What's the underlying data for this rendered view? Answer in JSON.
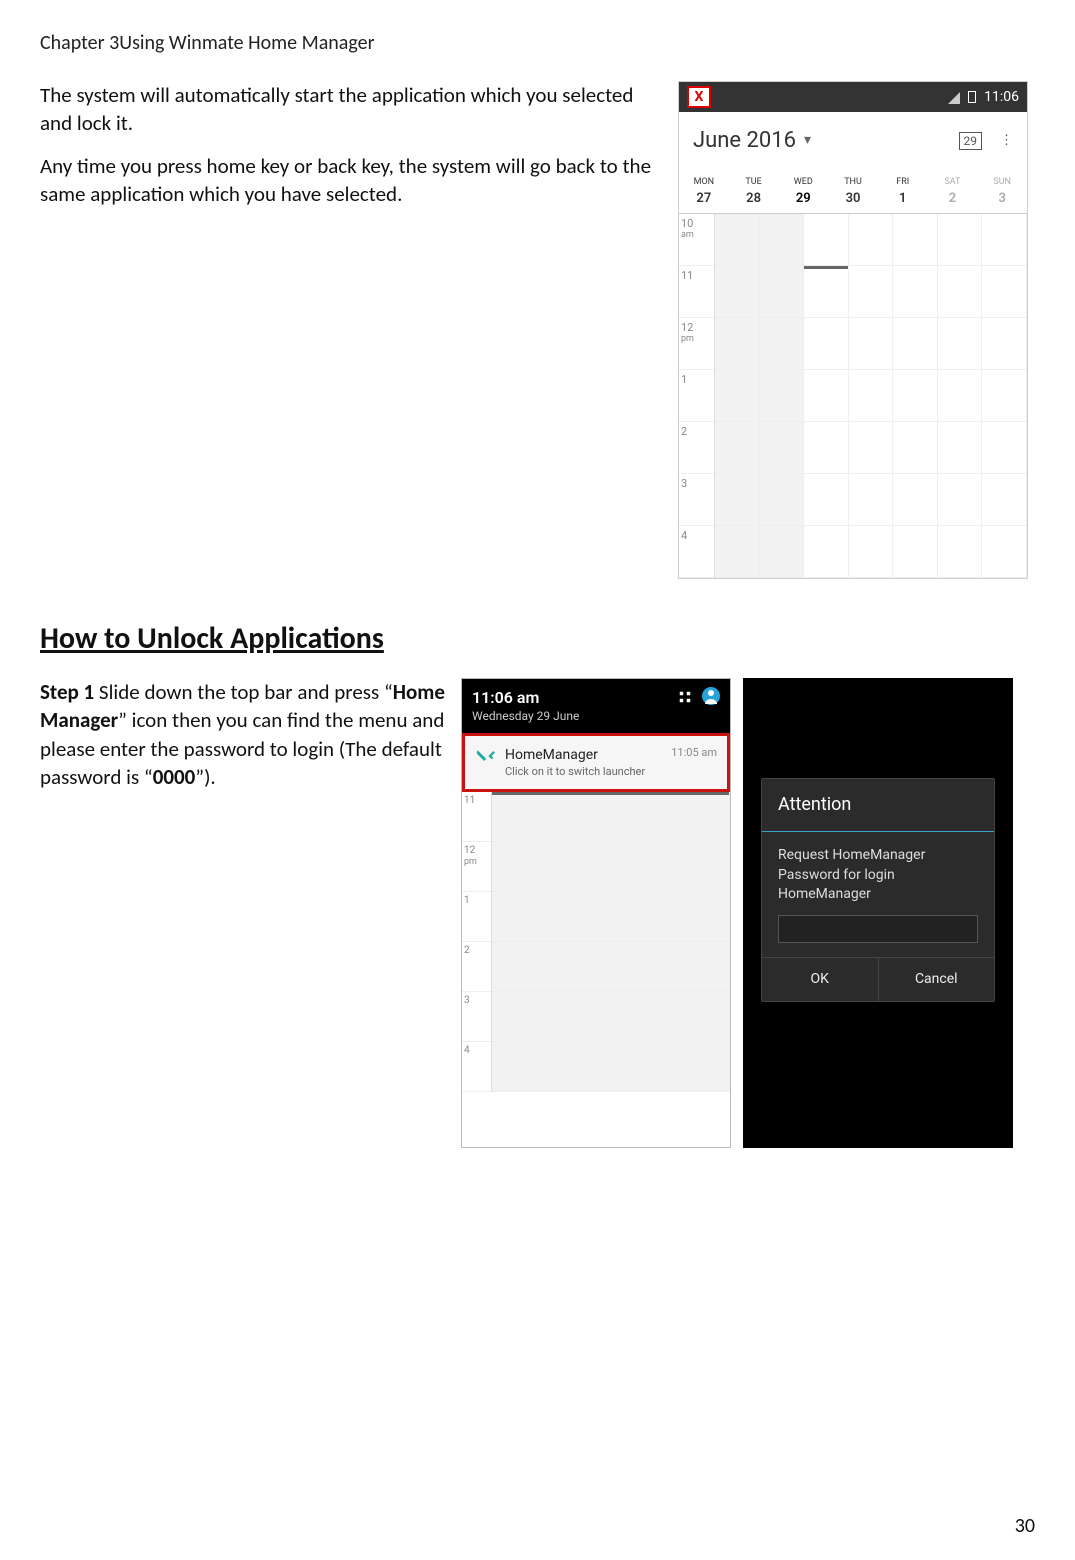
{
  "header": "Chapter 3Using Winmate Home Manager",
  "section1": {
    "p1": "The system will automatically start the application which you selected and lock it.",
    "p2": "Any time you press home key or back key, the system will go back to the same application which you have selected."
  },
  "section2": {
    "title": "How to Unlock Applications",
    "step1_prefix": "Step 1",
    "step1_a": " Slide down the top bar and press “",
    "step1_bold": "Home Manager",
    "step1_b": "” icon then you can find the menu and please enter the password to login (The default password is “",
    "step1_bold2": "0000",
    "step1_c": "”)."
  },
  "fig1": {
    "statusbar_icon": "X",
    "status_time": "11:06",
    "month_label": "June 2016",
    "date_badge": "29",
    "more_glyph": "⋮",
    "days": [
      {
        "name": "MON",
        "num": "27"
      },
      {
        "name": "TUE",
        "num": "28"
      },
      {
        "name": "WED",
        "num": "29"
      },
      {
        "name": "THU",
        "num": "30"
      },
      {
        "name": "FRI",
        "num": "1"
      },
      {
        "name": "SAT",
        "num": "2"
      },
      {
        "name": "SUN",
        "num": "3"
      }
    ],
    "hours": [
      {
        "h": "10",
        "ampm": "am"
      },
      {
        "h": "11",
        "ampm": ""
      },
      {
        "h": "12",
        "ampm": "pm"
      },
      {
        "h": "1",
        "ampm": ""
      },
      {
        "h": "2",
        "ampm": ""
      },
      {
        "h": "3",
        "ampm": ""
      },
      {
        "h": "4",
        "ampm": ""
      }
    ]
  },
  "fig2": {
    "time": "11:06 am",
    "date": "Wednesday 29 June",
    "notif_title": "HomeManager",
    "notif_body": "Click on it to switch launcher",
    "notif_time": "11:05 am",
    "hours": [
      "11",
      "12",
      "1",
      "2",
      "3",
      "4"
    ],
    "ampm12": "pm"
  },
  "fig3": {
    "dialog_title": "Attention",
    "dialog_body": "Request HomeManager Password for login HomeManager",
    "ok": "OK",
    "cancel": "Cancel"
  },
  "page_number": "30"
}
